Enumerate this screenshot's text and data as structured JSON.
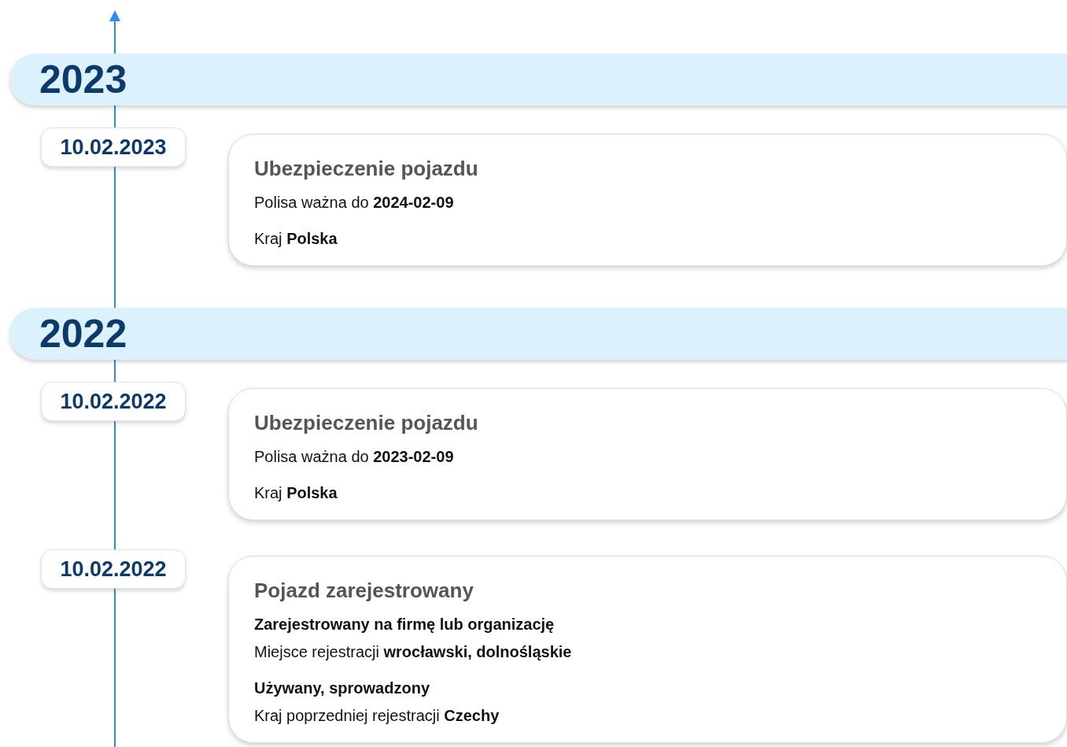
{
  "timeline": [
    {
      "year": "2023",
      "events": [
        {
          "date": "10.02.2023",
          "title": "Ubezpieczenie pojazdu",
          "groups": [
            [
              {
                "kind": "detail",
                "text": "Polisa ważna do **2024-02-09**"
              }
            ],
            [
              {
                "kind": "detail",
                "text": "Kraj **Polska**"
              }
            ]
          ]
        }
      ]
    },
    {
      "year": "2022",
      "events": [
        {
          "date": "10.02.2022",
          "title": "Ubezpieczenie pojazdu",
          "groups": [
            [
              {
                "kind": "detail",
                "text": "Polisa ważna do **2023-02-09**"
              }
            ],
            [
              {
                "kind": "detail",
                "text": "Kraj **Polska**"
              }
            ]
          ]
        },
        {
          "date": "10.02.2022",
          "title": "Pojazd zarejestrowany",
          "groups": [
            [
              {
                "kind": "heading",
                "text": "Zarejestrowany na firmę lub organizację"
              },
              {
                "kind": "detail",
                "text": "Miejsce rejestracji **wrocławski, dolnośląskie**"
              }
            ],
            [
              {
                "kind": "heading",
                "text": "Używany, sprowadzony"
              },
              {
                "kind": "detail",
                "text": "Kraj poprzedniej rejestracji **Czechy**"
              }
            ]
          ]
        }
      ]
    }
  ]
}
